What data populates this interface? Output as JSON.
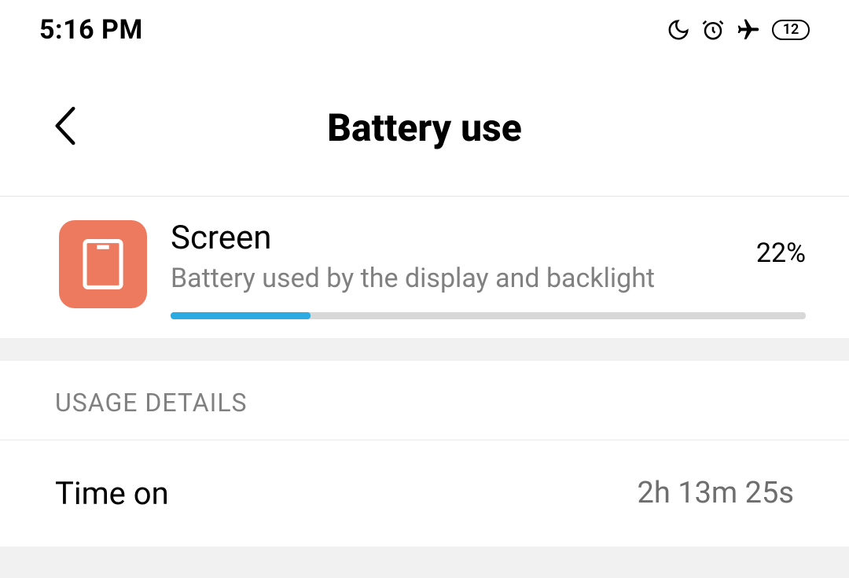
{
  "statusBar": {
    "time": "5:16 PM",
    "batteryLevel": "12"
  },
  "header": {
    "title": "Battery use"
  },
  "appRow": {
    "name": "Screen",
    "description": "Battery used by the display and backlight",
    "percent": "22%",
    "progressPercent": 22
  },
  "sectionHeader": "USAGE DETAILS",
  "details": [
    {
      "label": "Time on",
      "value": "2h 13m 25s"
    }
  ]
}
